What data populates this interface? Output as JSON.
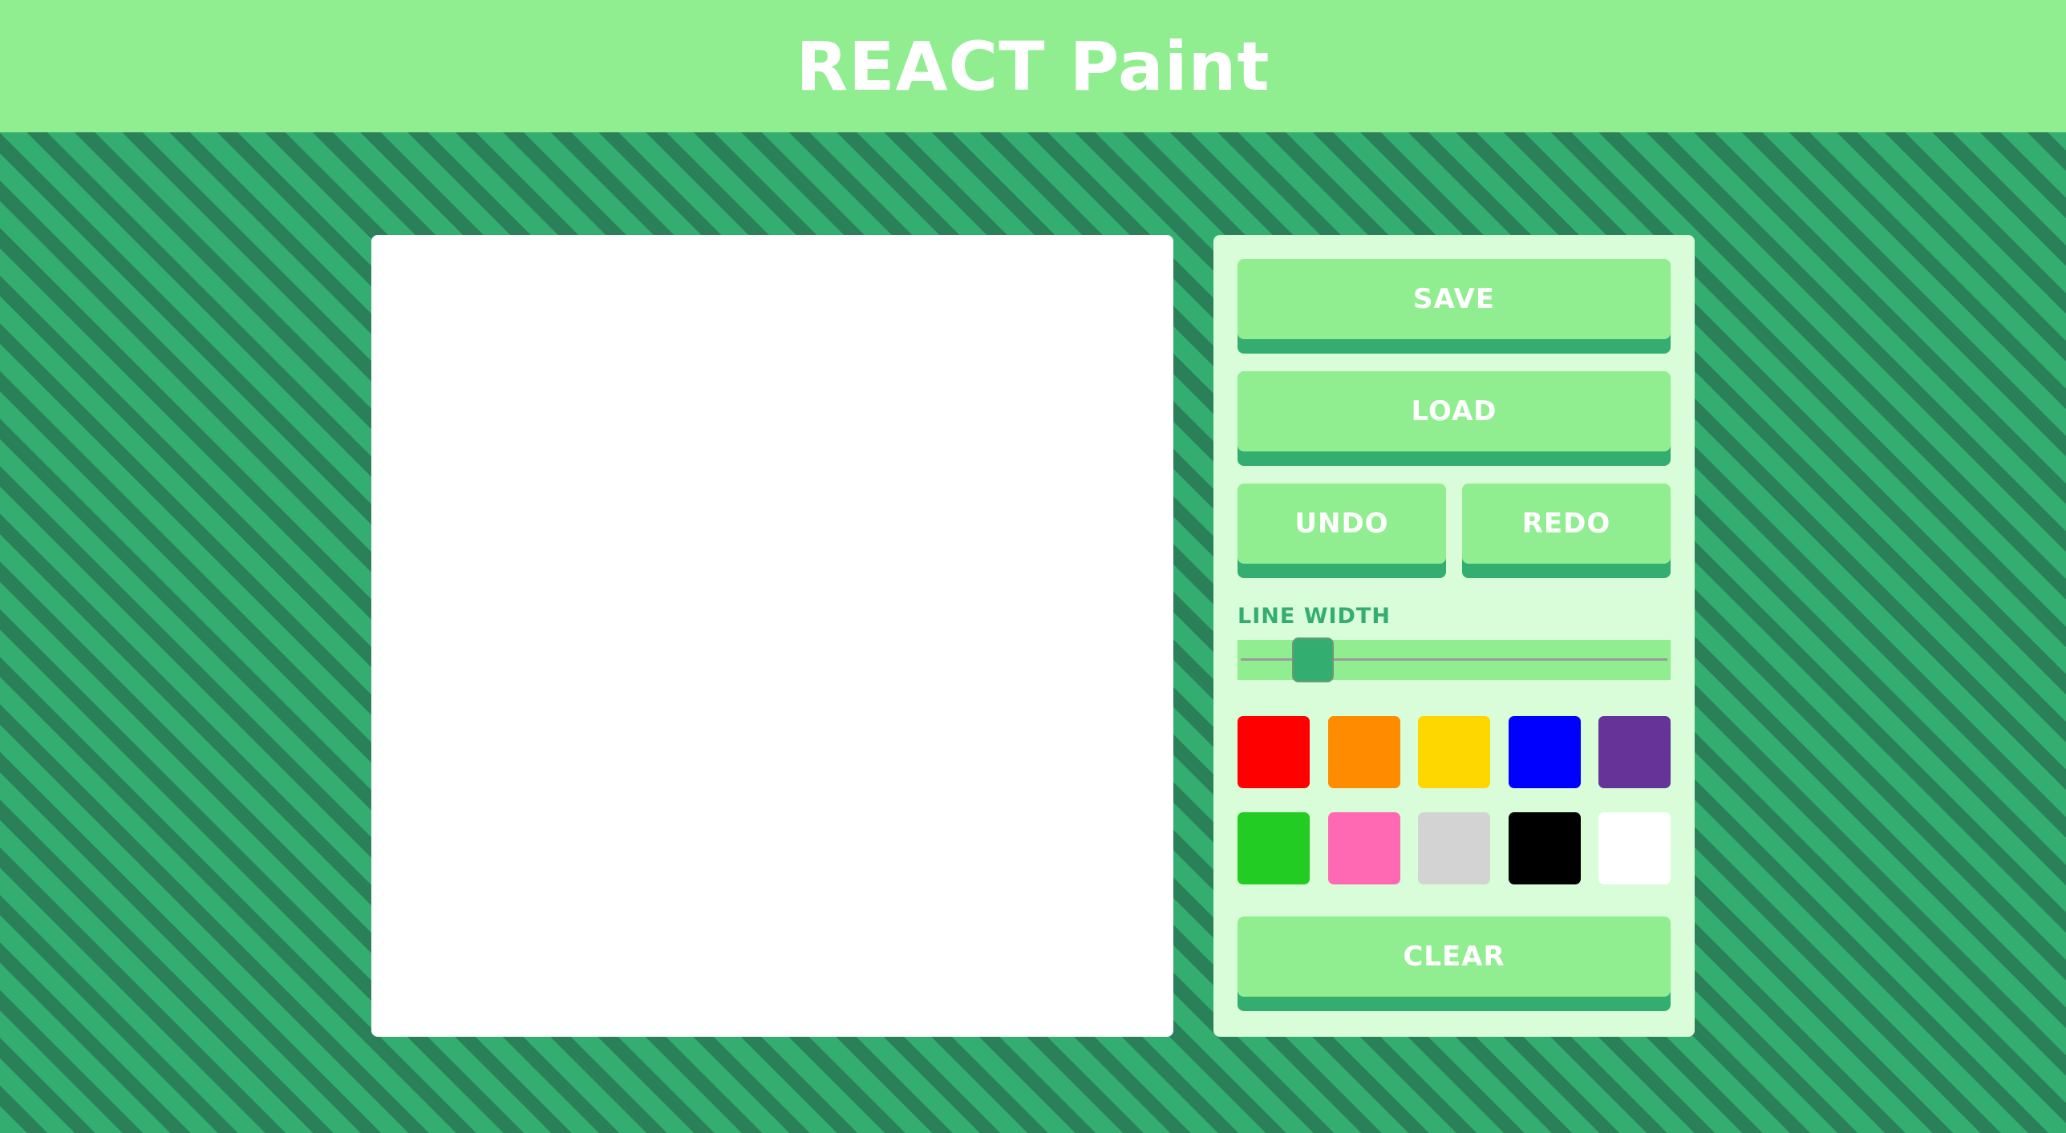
{
  "header": {
    "title": "REACT Paint"
  },
  "toolbox": {
    "save_label": "SAVE",
    "load_label": "LOAD",
    "undo_label": "UNDO",
    "redo_label": "REDO",
    "line_width_label": "LINE WIDTH",
    "clear_label": "CLEAR"
  },
  "line_width": {
    "value_fraction": 0.14
  },
  "swatches": [
    {
      "name": "red",
      "color": "#ff0000"
    },
    {
      "name": "orange",
      "color": "#ff8c00"
    },
    {
      "name": "yellow",
      "color": "#ffd700"
    },
    {
      "name": "blue",
      "color": "#0000ff"
    },
    {
      "name": "purple",
      "color": "#663399"
    },
    {
      "name": "green",
      "color": "#22cc22"
    },
    {
      "name": "pink",
      "color": "#ff69b4"
    },
    {
      "name": "light-gray",
      "color": "#d3d3d3"
    },
    {
      "name": "black",
      "color": "#000000"
    },
    {
      "name": "white",
      "color": "#ffffff"
    }
  ],
  "colors": {
    "header_bg": "#90ee90",
    "button_bg": "#90ee90",
    "button_shadow": "#33ad70",
    "toolbox_bg": "#d8fdd8",
    "stripe_light": "#33ad70",
    "stripe_dark": "#2a8058"
  }
}
